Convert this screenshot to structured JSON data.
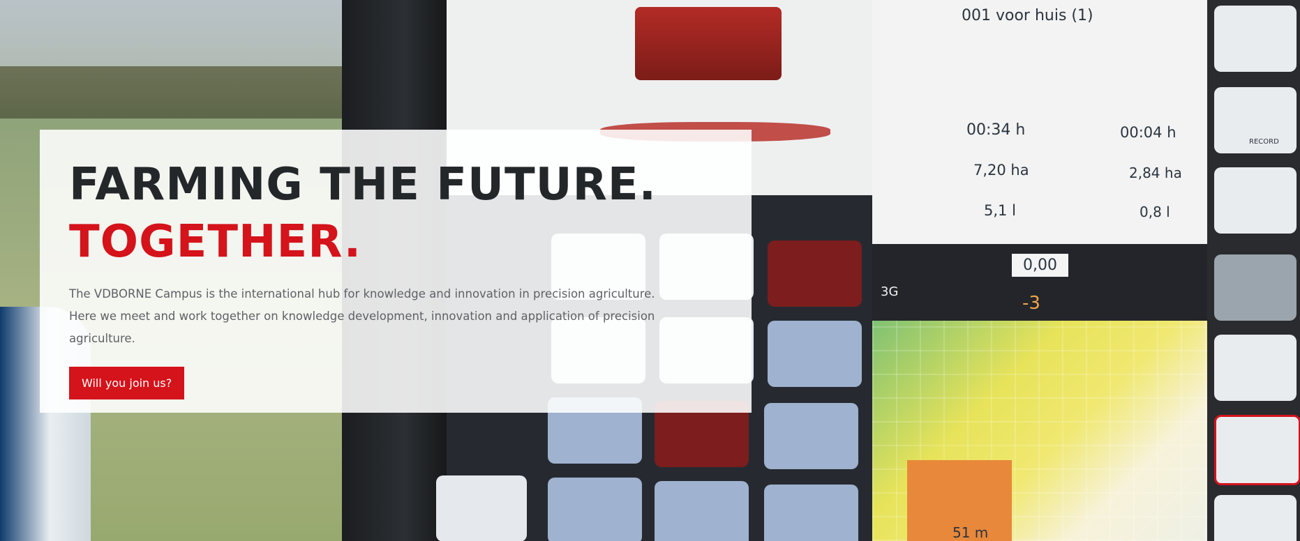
{
  "hero": {
    "title_line1": "FARMING THE FUTURE.",
    "title_line2": "TOGETHER.",
    "body": "The VDBORNE Campus is the international hub for knowledge and innovation in precision agriculture. Here we meet and work together on knowledge development, innovation and application of precision agriculture.",
    "cta_label": "Will you join us?"
  },
  "background_screen": {
    "field_name": "001 voor huis (1)",
    "left_timer": "00:34 h",
    "left_area": "7,20 ha",
    "left_fuel": "5,1 l",
    "right_timer": "00:04 h",
    "right_area": "2,84 ha",
    "right_fuel": "0,8 l",
    "counter": "0,00",
    "signal": "3G",
    "offset": "-3",
    "distance": "51 m",
    "record": "RECORD"
  },
  "colors": {
    "accent": "#d4131b",
    "title_dark": "#24272a"
  }
}
